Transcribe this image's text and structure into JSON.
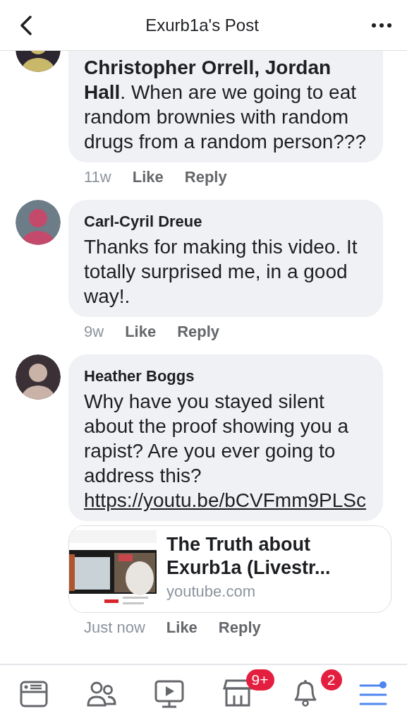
{
  "header": {
    "title": "Exurb1a's Post"
  },
  "comments": [
    {
      "text": "**Christopher Orrell, Jordan Hall**. When are we going to eat random brownies with random drugs from a random person???",
      "time": "11w",
      "actions": [
        "Like",
        "Reply"
      ]
    },
    {
      "author": "Carl-Cyril Dreue",
      "text": "Thanks for making this video. It totally surprised me, in a good way!.",
      "time": "9w",
      "actions": [
        "Like",
        "Reply"
      ]
    },
    {
      "author": "Heather Boggs",
      "text": "Why have you stayed silent about the proof showing you a rapist? Are you ever going to address this?",
      "link": "https://youtu.be/bCVFmm9PLSc",
      "preview": {
        "title": "The Truth about Exurb1a (Livestr...",
        "domain": "youtube.com"
      },
      "time": "Just now",
      "actions": [
        "Like",
        "Reply"
      ]
    }
  ],
  "nav": [
    {
      "kind": "feed",
      "selected": false
    },
    {
      "kind": "friends",
      "selected": false
    },
    {
      "kind": "video",
      "selected": false
    },
    {
      "kind": "marketplace",
      "selected": false,
      "badge": "9+"
    },
    {
      "kind": "notifications",
      "selected": false,
      "badge": "2"
    },
    {
      "kind": "menu",
      "selected": true
    }
  ]
}
